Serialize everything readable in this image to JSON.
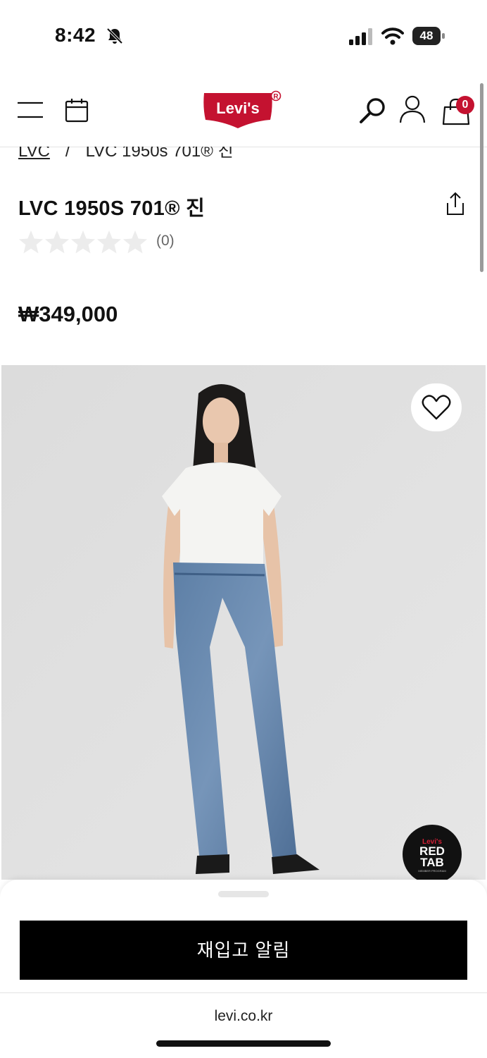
{
  "status_bar": {
    "time": "8:42",
    "battery": "48"
  },
  "header": {
    "logo_text": "Levi's",
    "cart_count": "0"
  },
  "breadcrumb": {
    "parent": "LVC",
    "separator": "/",
    "current": "LVC 1950s 701® 진"
  },
  "product": {
    "title": "LVC 1950S 701® 진",
    "rating": 0,
    "review_count": "(0)",
    "price": "₩349,000"
  },
  "badge": {
    "line1": "Levi's",
    "line2": "RED",
    "line3": "TAB",
    "line4": "MEMBER PROGRAM"
  },
  "bottom_sheet": {
    "notify_button": "재입고 알림"
  },
  "browser": {
    "url": "levi.co.kr"
  },
  "colors": {
    "brand_red": "#c41230",
    "star_empty": "#ececec"
  }
}
